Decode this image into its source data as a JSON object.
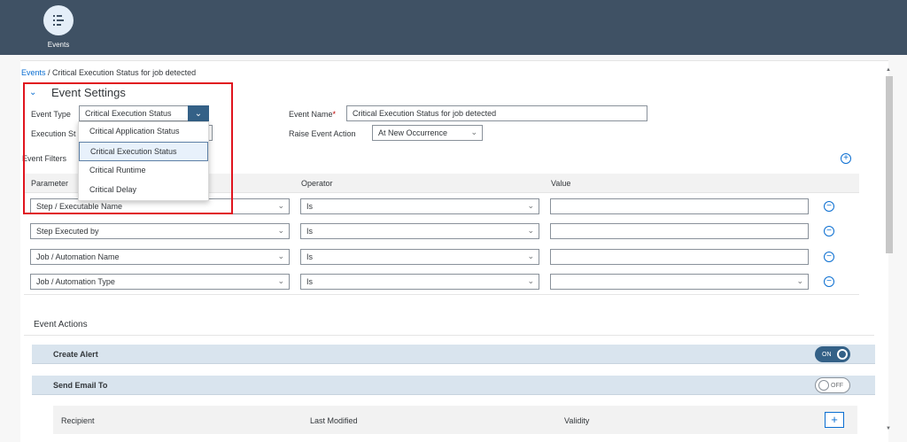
{
  "topbar": {
    "nav_item_label": "Events",
    "nav_icon": "events-icon",
    "bg_color": "#3f5164"
  },
  "breadcrumb": {
    "parent": "Events",
    "separator": " / ",
    "current": "Critical Execution Status for job detected"
  },
  "event_settings": {
    "title": "Event Settings",
    "event_type_label": "Event Type",
    "event_type_value": "Critical Execution Status",
    "event_name_label": "Event Name",
    "event_name_required": "*",
    "event_name_value": "Critical Execution Status for job  detected",
    "execution_status_label": "Execution St",
    "raise_event_action_label": "Raise Event Action",
    "raise_event_action_value": "At New Occurrence",
    "event_type_options": [
      "Critical Application Status",
      "Critical Execution Status",
      "Critical Runtime",
      "Critical Delay"
    ],
    "selected_option": "Critical Execution Status"
  },
  "event_filters": {
    "label": "Event Filters",
    "columns": [
      "Parameter",
      "Operator",
      "Value"
    ],
    "rows": [
      {
        "parameter": "Step / Executable Name",
        "operator": "Is",
        "value": ""
      },
      {
        "parameter": "Step Executed by",
        "operator": "Is",
        "value": ""
      },
      {
        "parameter": "Job / Automation Name",
        "operator": "Is",
        "value": ""
      },
      {
        "parameter": "Job / Automation Type",
        "operator": "Is",
        "value": ""
      }
    ]
  },
  "event_actions": {
    "title": "Event Actions",
    "create_alert_label": "Create Alert",
    "create_alert_toggle": "ON",
    "send_email_label": "Send Email To",
    "send_email_toggle": "OFF",
    "recipient_columns": [
      "Recipient",
      "Last Modified",
      "Validity"
    ]
  },
  "colors": {
    "accent": "#0a6ed1",
    "highlight_border": "#e0141e",
    "toggle_on": "#346187"
  }
}
